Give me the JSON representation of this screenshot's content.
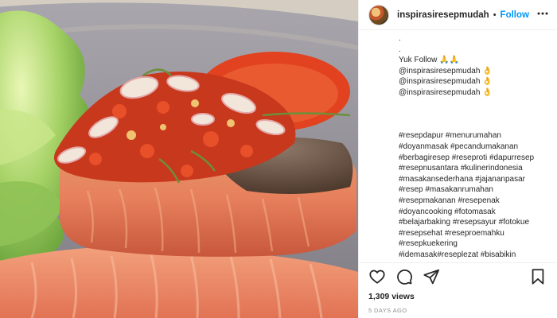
{
  "media": {
    "alt": "",
    "background_color": "#8f8c95"
  },
  "header": {
    "username": "inspirasiresepmudah",
    "separator": "•",
    "follow_label": "Follow",
    "more_icon": "more-options-icon"
  },
  "caption": {
    "dot_lines": [
      ".",
      "."
    ],
    "follow_prompt": "Yuk Follow 🙏🙏",
    "mentions": [
      "@inspirasiresepmudah 👌",
      "@inspirasiresepmudah 👌",
      "@inspirasiresepmudah 👌"
    ],
    "hashtag_lines": [
      "#resepdapur #menurumahan",
      "#doyanmasak #pecandumakanan",
      "#berbagiresep #reseproti #dapurresep",
      "#resepnusantara #kulinerindonesia",
      "#masakansederhana #jajananpasar",
      "#resep #masakanrumahan",
      "#resepmakanan #resepenak",
      "#doyancooking #fotomasak",
      "#belajarbaking #resepsayur #fotokue",
      "#resepsehat #reseproemahku",
      "#resepkuekering",
      "#idemasak#reseplezat #bisabikin"
    ]
  },
  "actions": {
    "like_icon": "heart-icon",
    "comment_icon": "comment-icon",
    "share_icon": "share-icon",
    "save_icon": "bookmark-icon",
    "views_text": "1,309 views",
    "time_ago": "5 DAYS AGO"
  },
  "colors": {
    "accent": "#0095f6",
    "text": "#262626",
    "muted": "#8e8e8e",
    "border": "#efefef"
  }
}
